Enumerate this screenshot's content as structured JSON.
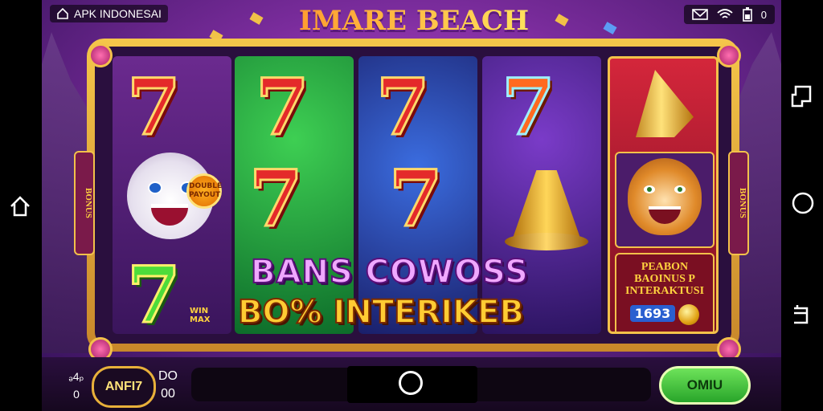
{
  "brand": {
    "label": "APK INDONESAI"
  },
  "status": {
    "signal": "0"
  },
  "title": "IMARE BEACH",
  "reels": {
    "r1": {
      "badge": "DOUBLE PAYOUT",
      "sev_small_label": "WIN MAX"
    },
    "side_left": "BONUS",
    "side_right": "BONUS"
  },
  "bonus_panel": {
    "line1": "PEABON",
    "line2": "BAOINUS P",
    "line3": "INTERAKTUSI",
    "number": "1693"
  },
  "banner": {
    "line1": "BANS COWOSS",
    "line2": "BO% INTERIKEB"
  },
  "bottom": {
    "left_top": "ₔ4ₚ",
    "left_bottom": "0",
    "anti_button": "ANFI7",
    "right_top": "DO",
    "right_bottom": "00",
    "spin_button": "OMIU"
  },
  "icons": {
    "left_nav": "home-icon",
    "right_nav": [
      "recent-apps-icon",
      "circle-home-icon",
      "back-icon"
    ]
  },
  "colors": {
    "accent": "#f3c14a",
    "spin": "#28a52a",
    "bg": "#7a2c9c"
  }
}
